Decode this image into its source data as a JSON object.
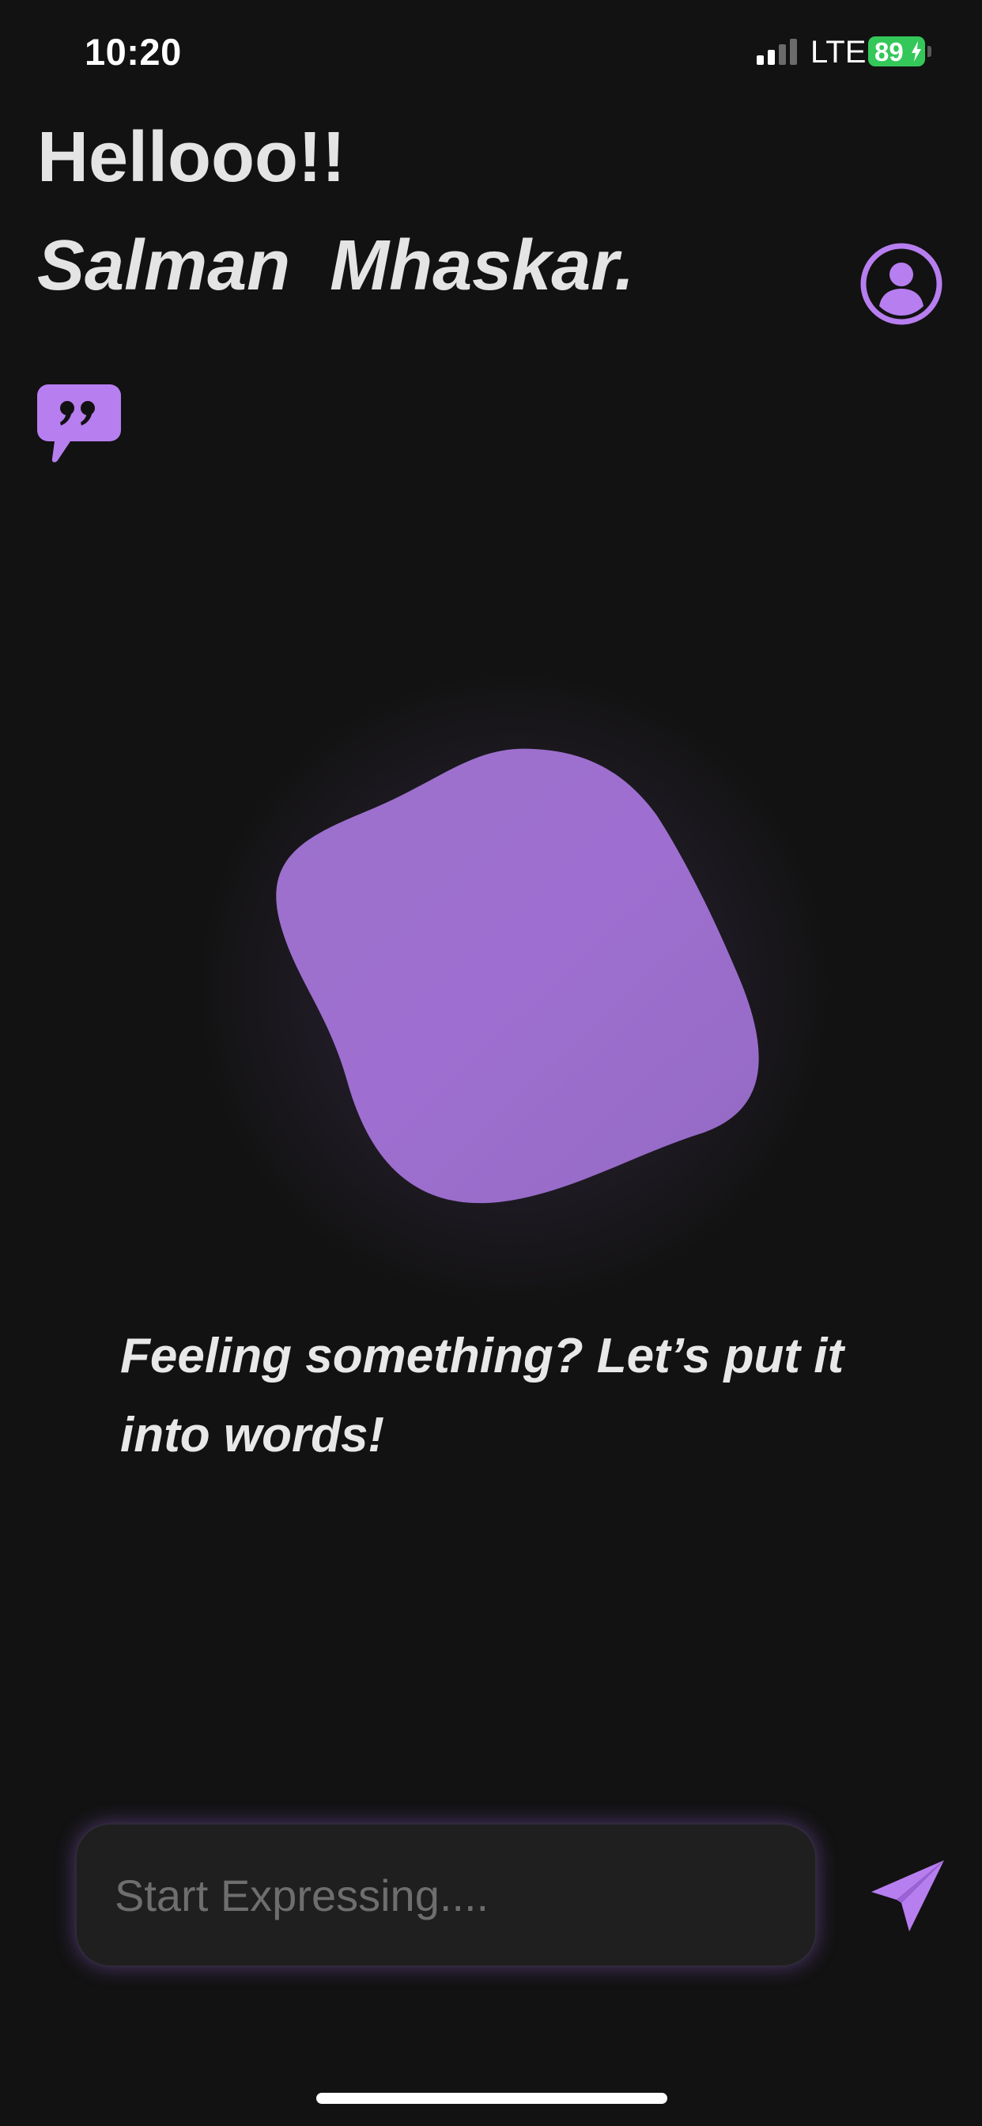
{
  "status_bar": {
    "time": "10:20",
    "network": "LTE",
    "battery": "89",
    "signal_icon": "cellular-signal-icon",
    "battery_color": "#34c759"
  },
  "header": {
    "greeting": "Hellooo!!",
    "user_name": "Salman  Mhaskar.",
    "profile_icon": "user-circle-icon",
    "quote_icon": "quote-bubble-icon"
  },
  "main": {
    "prompt": "Feeling something? Let’s put it into words!",
    "blob_color": "#9b6ecb"
  },
  "composer": {
    "placeholder": "Start Expressing....",
    "value": "",
    "send_icon": "paper-plane-icon"
  },
  "theme": {
    "accent": "#b77ef0",
    "background": "#121212"
  }
}
